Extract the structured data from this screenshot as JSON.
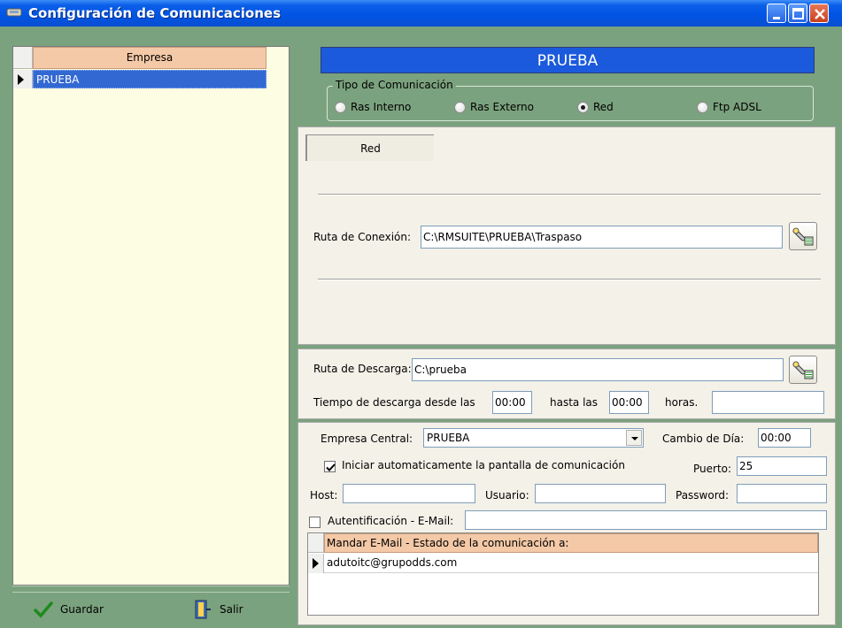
{
  "window": {
    "title": "Configuración de Comunicaciones"
  },
  "left": {
    "grid_header": "Empresa",
    "rows": [
      "PRUEBA"
    ],
    "save_label": "Guardar",
    "exit_label": "Salir"
  },
  "company_banner": "PRUEBA",
  "tipo": {
    "legend": "Tipo de Comunicación",
    "options": [
      "Ras Interno",
      "Ras Externo",
      "Red",
      "Ftp ADSL"
    ],
    "selected": "Red"
  },
  "red_panel": {
    "tab_label": "Red",
    "ruta_label": "Ruta de Conexión:",
    "ruta_value": "C:\\RMSUITE\\PRUEBA\\Traspaso"
  },
  "descarga": {
    "ruta_label": "Ruta de Descarga:",
    "ruta_value": "C:\\prueba",
    "tiempo_label": "Tiempo de descarga desde las",
    "desde_value": "00:00",
    "hasta_label": "hasta las",
    "hasta_value": "00:00",
    "horas_label": "horas.",
    "horas_value": ""
  },
  "email": {
    "empresa_central_label": "Empresa Central:",
    "empresa_central_value": "PRUEBA",
    "cambio_dia_label": "Cambio de Día:",
    "cambio_dia_value": "00:00",
    "iniciar_label": "Iniciar automaticamente la pantalla de comunicación",
    "iniciar_checked": true,
    "puerto_label": "Puerto:",
    "puerto_value": "25",
    "host_label": "Host:",
    "host_value": "",
    "usuario_label": "Usuario:",
    "usuario_value": "",
    "password_label": "Password:",
    "password_value": "",
    "autenticacion_label": "Autentificación - E-Mail:",
    "autenticacion_checked": false,
    "autenticacion_value": "",
    "grid_header": "Mandar E-Mail - Estado de la comunicación a:",
    "grid_rows": [
      "adutoitc@grupodds.com"
    ]
  },
  "colors": {
    "window_bg": "#7ba27e",
    "titlebar": "#0054e3",
    "banner": "#1b5adc",
    "grid_header": "#f4c9a7",
    "left_grid_bg": "#fdfde3",
    "selection": "#3268d2"
  }
}
